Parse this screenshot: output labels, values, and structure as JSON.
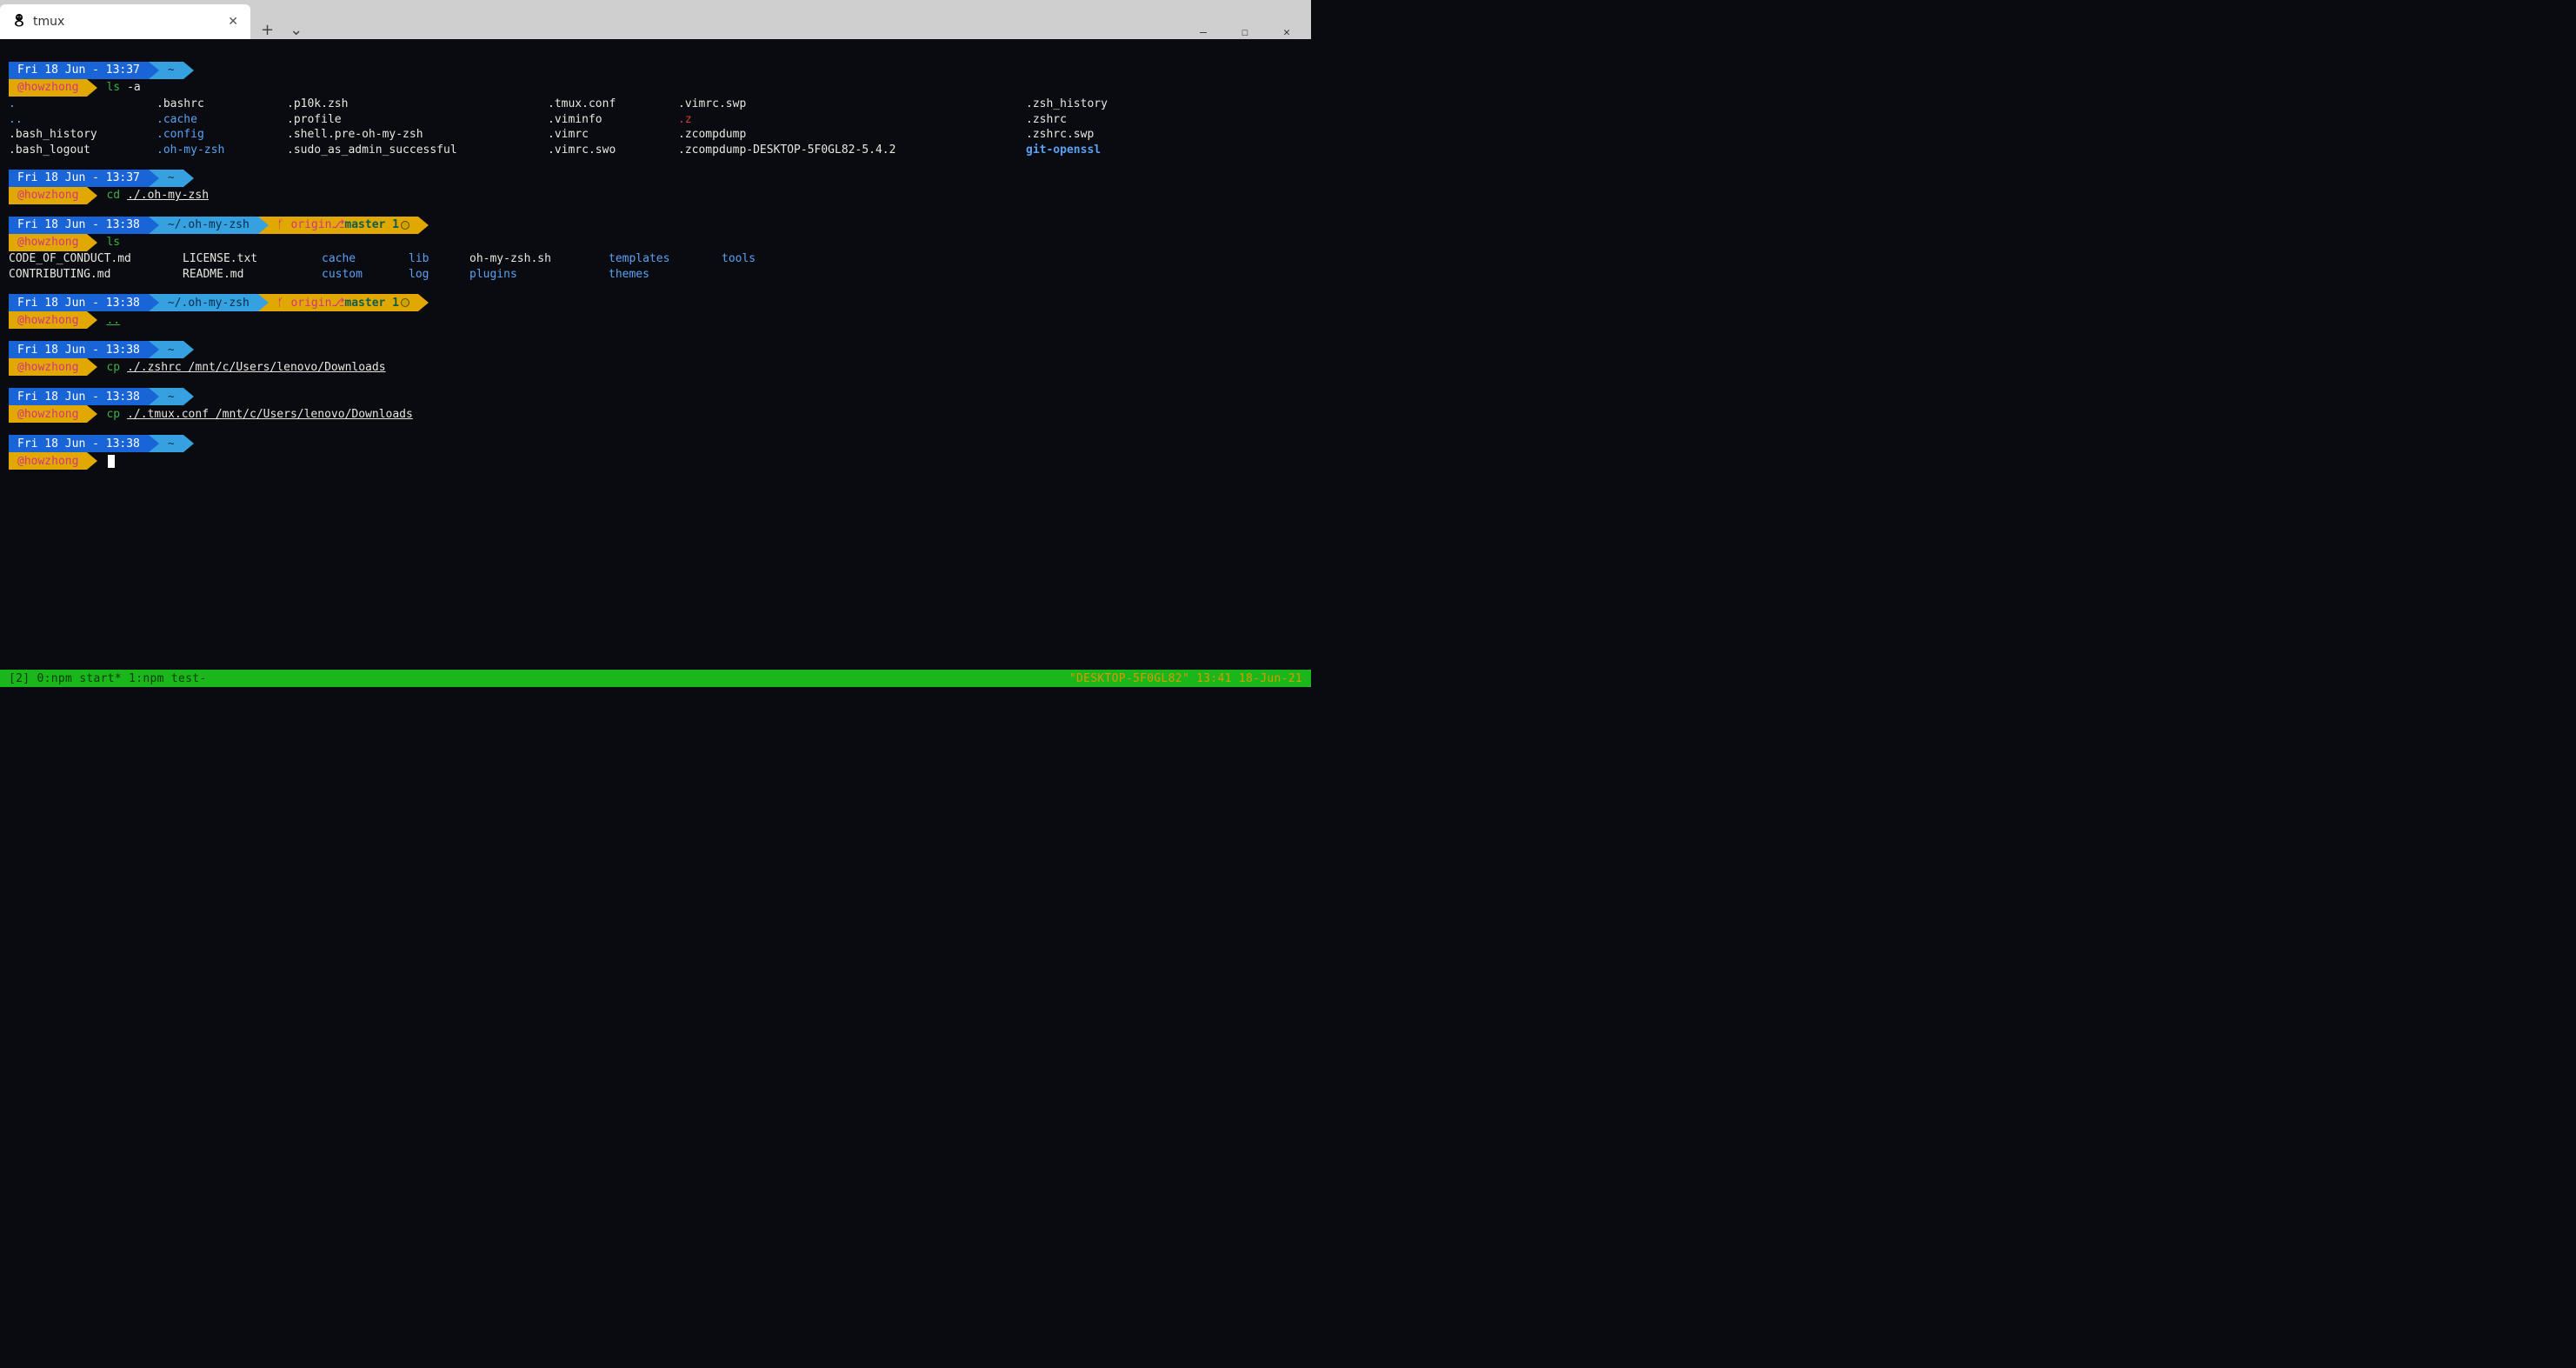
{
  "window": {
    "tab_title": "tmux",
    "new_tab_glyph": "+",
    "dropdown_glyph": "⌄",
    "min_glyph": "—",
    "max_glyph": "☐",
    "close_glyph": "✕"
  },
  "prompts": [
    {
      "time": "Fri 18 Jun - 13:37",
      "dir": "~",
      "git": null,
      "user": "@howzhong",
      "cmd": "ls",
      "args": "-a",
      "args_underline": false,
      "cursor": false,
      "output": {
        "type": "ls-home"
      }
    },
    {
      "time": "Fri 18 Jun - 13:37",
      "dir": "~",
      "git": null,
      "user": "@howzhong",
      "cmd": "cd",
      "args": "./.oh-my-zsh",
      "args_underline": true,
      "cursor": false,
      "output": null
    },
    {
      "time": "Fri 18 Jun - 13:38",
      "dir": "~/.oh-my-zsh",
      "git": {
        "origin": "origin",
        "branch": "master",
        "ahead": "1"
      },
      "user": "@howzhong",
      "cmd": "ls",
      "args": "",
      "args_underline": false,
      "cursor": false,
      "output": {
        "type": "ls-omz"
      }
    },
    {
      "time": "Fri 18 Jun - 13:38",
      "dir": "~/.oh-my-zsh",
      "git": {
        "origin": "origin",
        "branch": "master",
        "ahead": "1"
      },
      "user": "@howzhong",
      "cmd": "..",
      "cmd_underline": true,
      "args": "",
      "cursor": false,
      "output": null
    },
    {
      "time": "Fri 18 Jun - 13:38",
      "dir": "~",
      "git": null,
      "user": "@howzhong",
      "cmd": "cp",
      "args": "./.zshrc /mnt/c/Users/lenovo/Downloads",
      "args_underline": true,
      "cursor": false,
      "output": null
    },
    {
      "time": "Fri 18 Jun - 13:38",
      "dir": "~",
      "git": null,
      "user": "@howzhong",
      "cmd": "cp",
      "args": "./.tmux.conf /mnt/c/Users/lenovo/Downloads",
      "args_underline": true,
      "cursor": false,
      "output": null
    },
    {
      "time": "Fri 18 Jun - 13:38",
      "dir": "~",
      "git": null,
      "user": "@howzhong",
      "cmd": "",
      "args": "",
      "cursor": true,
      "output": null
    }
  ],
  "ls_home": {
    "cols": [
      "170px",
      "150px",
      "300px",
      "150px",
      "400px",
      "180px"
    ],
    "rows": [
      [
        {
          "t": ".",
          "c": "dir"
        },
        {
          "t": ".bashrc",
          "c": "file"
        },
        {
          "t": ".p10k.zsh",
          "c": "file"
        },
        {
          "t": ".tmux.conf",
          "c": "file"
        },
        {
          "t": ".vimrc.swp",
          "c": "file"
        },
        {
          "t": ".zsh_history",
          "c": "file"
        }
      ],
      [
        {
          "t": "..",
          "c": "dir"
        },
        {
          "t": ".cache",
          "c": "dir"
        },
        {
          "t": ".profile",
          "c": "file"
        },
        {
          "t": ".viminfo",
          "c": "file"
        },
        {
          "t": ".z",
          "c": "red"
        },
        {
          "t": ".zshrc",
          "c": "file"
        }
      ],
      [
        {
          "t": ".bash_history",
          "c": "file"
        },
        {
          "t": ".config",
          "c": "dir"
        },
        {
          "t": ".shell.pre-oh-my-zsh",
          "c": "file"
        },
        {
          "t": ".vimrc",
          "c": "file"
        },
        {
          "t": ".zcompdump",
          "c": "file"
        },
        {
          "t": ".zshrc.swp",
          "c": "file"
        }
      ],
      [
        {
          "t": ".bash_logout",
          "c": "file"
        },
        {
          "t": ".oh-my-zsh",
          "c": "dir"
        },
        {
          "t": ".sudo_as_admin_successful",
          "c": "file"
        },
        {
          "t": ".vimrc.swo",
          "c": "file"
        },
        {
          "t": ".zcompdump-DESKTOP-5F0GL82-5.4.2",
          "c": "file"
        },
        {
          "t": "git-openssl",
          "c": "dirbold"
        }
      ]
    ]
  },
  "ls_omz": {
    "cols": [
      "200px",
      "160px",
      "100px",
      "70px",
      "160px",
      "130px",
      "100px"
    ],
    "rows": [
      [
        {
          "t": "CODE_OF_CONDUCT.md",
          "c": "file"
        },
        {
          "t": "LICENSE.txt",
          "c": "file"
        },
        {
          "t": "cache",
          "c": "dir"
        },
        {
          "t": "lib",
          "c": "dir"
        },
        {
          "t": "oh-my-zsh.sh",
          "c": "file"
        },
        {
          "t": "templates",
          "c": "dir"
        },
        {
          "t": "tools",
          "c": "dir"
        }
      ],
      [
        {
          "t": "CONTRIBUTING.md",
          "c": "file"
        },
        {
          "t": "README.md",
          "c": "file"
        },
        {
          "t": "custom",
          "c": "dir"
        },
        {
          "t": "log",
          "c": "dir"
        },
        {
          "t": "plugins",
          "c": "dir"
        },
        {
          "t": "themes",
          "c": "dir"
        },
        {
          "t": "",
          "c": "file"
        }
      ]
    ]
  },
  "status": {
    "left": "[2] 0:npm start* 1:npm test-",
    "right": "\"DESKTOP-5F0GL82\" 13:41 18-Jun-21"
  }
}
